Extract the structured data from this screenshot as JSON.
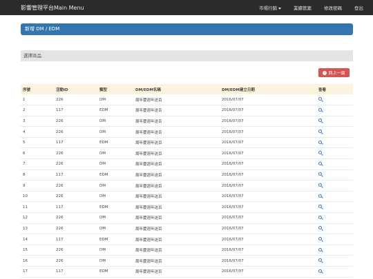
{
  "navbar": {
    "brand": "影響管理平台Main Menu",
    "items": [
      {
        "label": "市場行銷",
        "dropdown": true
      },
      {
        "label": "業績管案",
        "dropdown": false
      },
      {
        "label": "修改密碼",
        "dropdown": false
      },
      {
        "label": "登出",
        "dropdown": false
      }
    ]
  },
  "page": {
    "title": "新增 DM / EDM",
    "section_title": "選擇商品",
    "back_button": "回上一頁"
  },
  "table": {
    "headers": [
      "序號",
      "活動ID",
      "類型",
      "DM/EDM名稱",
      "DM/EDM建立日期",
      "查看"
    ],
    "rows": [
      {
        "seq": "1",
        "id": "226",
        "type": "DM",
        "name": "周年慶週年送百",
        "date": "2016/07/07"
      },
      {
        "seq": "2",
        "id": "117",
        "type": "EDM",
        "name": "周年慶週年送百",
        "date": "2016/07/07"
      },
      {
        "seq": "3",
        "id": "226",
        "type": "DM",
        "name": "周年慶週年送百",
        "date": "2016/07/07"
      },
      {
        "seq": "4",
        "id": "226",
        "type": "DM",
        "name": "周年慶週年送百",
        "date": "2016/07/07"
      },
      {
        "seq": "5",
        "id": "117",
        "type": "EDM",
        "name": "周年慶週年送百",
        "date": "2016/07/07"
      },
      {
        "seq": "6",
        "id": "226",
        "type": "DM",
        "name": "周年慶週年送百",
        "date": "2016/07/07"
      },
      {
        "seq": "7",
        "id": "226",
        "type": "DM",
        "name": "周年慶週年送百",
        "date": "2016/07/07"
      },
      {
        "seq": "8",
        "id": "117",
        "type": "EDM",
        "name": "周年慶週年送百",
        "date": "2016/07/07"
      },
      {
        "seq": "9",
        "id": "226",
        "type": "DM",
        "name": "周年慶週年送百",
        "date": "2016/07/07"
      },
      {
        "seq": "10",
        "id": "226",
        "type": "DM",
        "name": "周年慶週年送百",
        "date": "2016/07/07"
      },
      {
        "seq": "11",
        "id": "117",
        "type": "EDM",
        "name": "周年慶週年送百",
        "date": "2016/07/07"
      },
      {
        "seq": "12",
        "id": "226",
        "type": "DM",
        "name": "周年慶週年送百",
        "date": "2016/07/07"
      },
      {
        "seq": "13",
        "id": "226",
        "type": "DM",
        "name": "周年慶週年送百",
        "date": "2016/07/07"
      },
      {
        "seq": "14",
        "id": "117",
        "type": "EDM",
        "name": "周年慶週年送百",
        "date": "2016/07/07"
      },
      {
        "seq": "15",
        "id": "226",
        "type": "DM",
        "name": "周年慶週年送百",
        "date": "2016/07/07"
      },
      {
        "seq": "16",
        "id": "226",
        "type": "DM",
        "name": "周年慶週年送百",
        "date": "2016/07/07"
      },
      {
        "seq": "17",
        "id": "117",
        "type": "EDM",
        "name": "周年慶週年送百",
        "date": "2016/07/07"
      }
    ]
  },
  "colors": {
    "navbar": "#2b2b2b",
    "title_bar": "#3276b1",
    "back_button": "#d9534f",
    "table_header": "#fbf3dc",
    "link_icon": "#3a7bc0"
  }
}
